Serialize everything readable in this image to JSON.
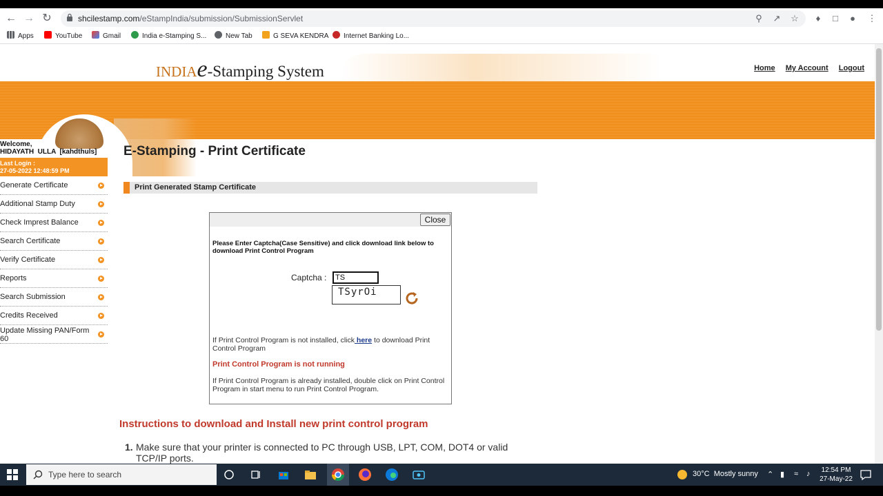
{
  "browser": {
    "url_host": "shcilestamp.com",
    "url_path": "/eStampIndia/submission/SubmissionServlet",
    "bookmarks": [
      "Apps",
      "YouTube",
      "Gmail",
      "India e-Stamping S...",
      "New Tab",
      "G SEVA KENDRA",
      "Internet Banking Lo..."
    ]
  },
  "header": {
    "logo_india": "INDIA",
    "logo_e": "e",
    "logo_rest": "-Stamping System",
    "links": [
      "Home",
      "My Account",
      "Logout"
    ]
  },
  "sidebar": {
    "welcome_line1": "Welcome,",
    "welcome_line2": "HIDAYATH  ULLA  [kahdthuls]",
    "last_login_label": "Last Login :",
    "last_login_value": "27-05-2022 12:48:59 PM",
    "items": [
      "Generate Certificate",
      "Additional Stamp Duty",
      "Check Impreст Balance",
      "Search Certificate",
      "Verify Certificate",
      "Reports",
      "Search Submission",
      "Credits Received",
      "Update Missing PAN/Form 60"
    ]
  },
  "main": {
    "title": "E-Stamping - Print Certificate",
    "section": "Print Generated Stamp Certificate"
  },
  "dialog": {
    "close_label": "Close",
    "instruction": "Please Enter Captcha(Case Sensitive) and click download link below to download Print Control Program",
    "captcha_label": "Captcha :",
    "captcha_value": "TS",
    "captcha_image_text": "TSyrOi",
    "p1_before": "If Print Control Program is not installed, click",
    "p1_link": " here",
    "p1_after": " to download Print Control Program",
    "warning": "Print Control Program is not running",
    "p2": "If Print Control Program is already installed, double click on Print Control Program in start menu to run Print Control Program."
  },
  "instructions": {
    "title": "Instructions to download and Install new print control program",
    "item_num": "1.",
    "item_text": "Make sure that your printer is connected to PC through USB, LPT, COM, DOT4 or valid TCP/IP ports."
  },
  "taskbar": {
    "search_placeholder": "Type here to search",
    "weather": "30°C  Mostly sunny",
    "time": "12:54 PM",
    "date": "27-May-22"
  }
}
